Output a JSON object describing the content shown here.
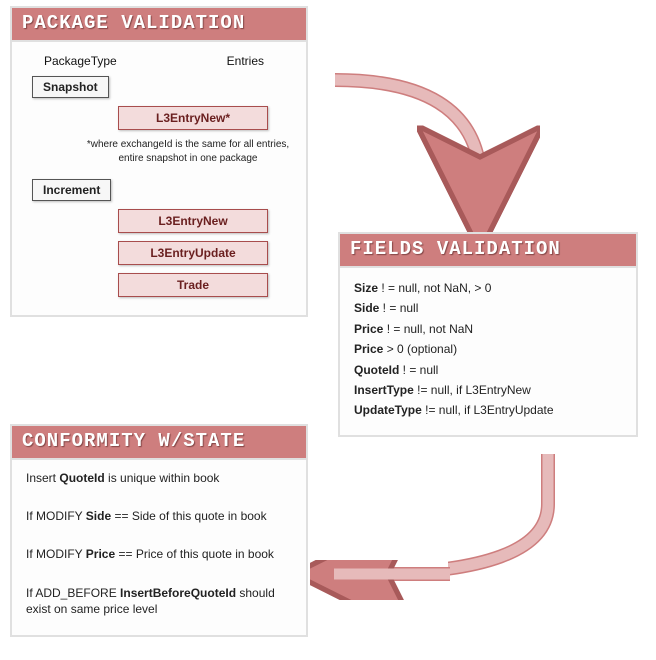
{
  "package_validation": {
    "title": "PACKAGE VALIDATION",
    "col1": "PackageType",
    "col2": "Entries",
    "snapshot": {
      "label": "Snapshot",
      "entry": "L3EntryNew*",
      "note": "*where exchangeId is the same for all entries, entire snapshot in one package"
    },
    "increment": {
      "label": "Increment",
      "entries": [
        "L3EntryNew",
        "L3EntryUpdate",
        "Trade"
      ]
    }
  },
  "fields_validation": {
    "title": "FIELDS VALIDATION",
    "rules": [
      {
        "field": "Size",
        "cond": " ! = null, not NaN, > 0"
      },
      {
        "field": "Side",
        "cond": " ! = null"
      },
      {
        "field": "Price",
        "cond": " ! = null, not NaN"
      },
      {
        "field": "Price",
        "cond": " > 0 (optional)"
      },
      {
        "field": "QuoteId",
        "cond": " ! = null"
      },
      {
        "field": "InsertType",
        "cond": " != null, if L3EntryNew"
      },
      {
        "field": "UpdateType",
        "cond": " != null, if L3EntryUpdate"
      }
    ]
  },
  "conformity": {
    "title": "CONFORMITY W/STATE",
    "rules": [
      {
        "pre": "Insert ",
        "bold": "QuoteId",
        "post": " is unique within book"
      },
      {
        "pre": "If MODIFY ",
        "bold": "Side",
        "post": " == Side of this quote in book"
      },
      {
        "pre": "If MODIFY ",
        "bold": "Price",
        "post": " == Price of this quote in book"
      },
      {
        "pre": "If ADD_BEFORE ",
        "bold": "InsertBeforeQuoteId",
        "post": " should exist on same price level"
      }
    ]
  }
}
